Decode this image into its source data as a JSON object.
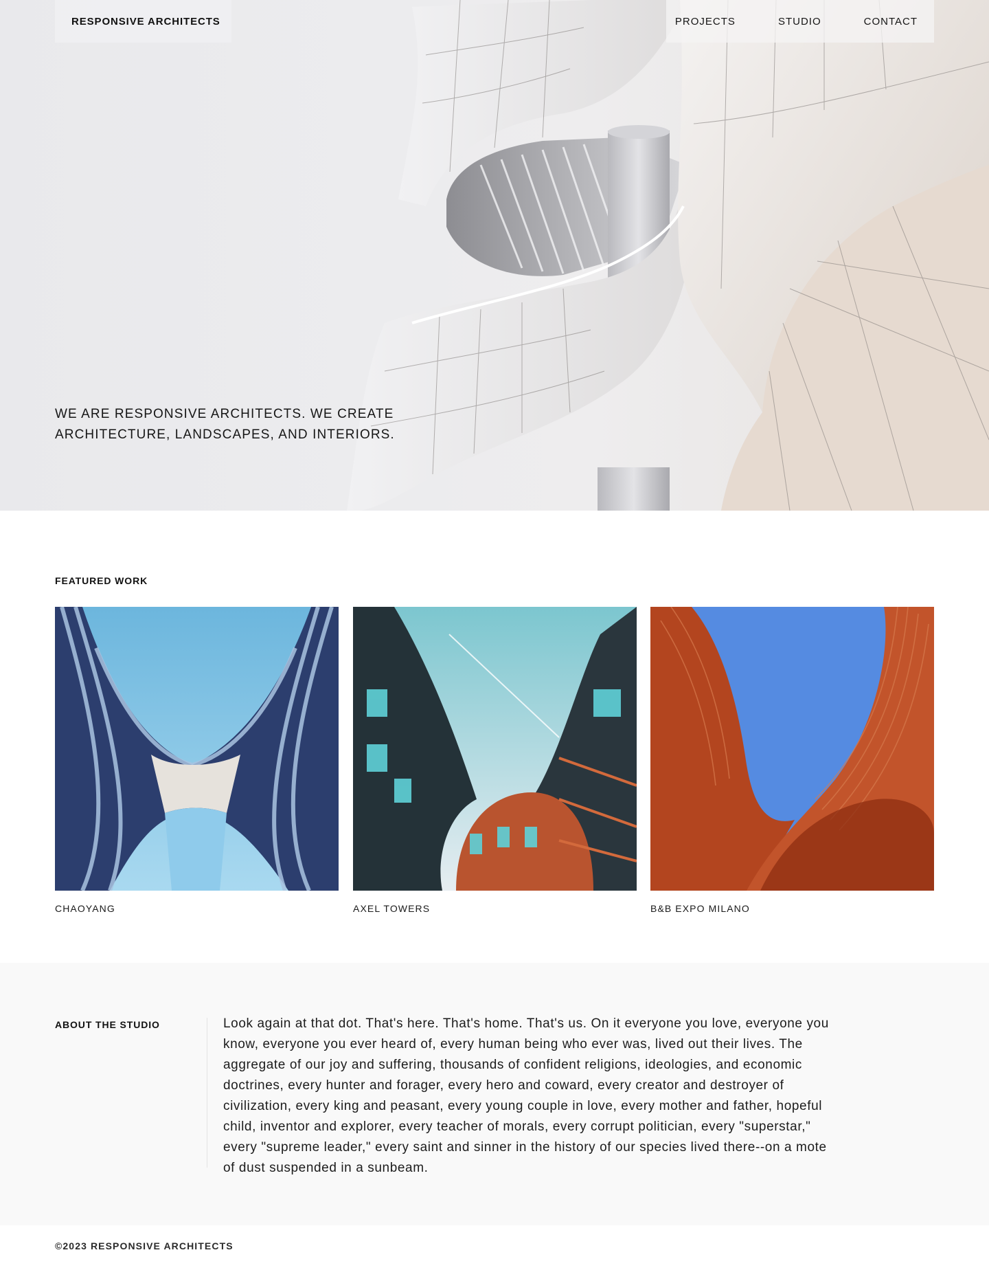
{
  "header": {
    "brand": "RESPONSIVE ARCHITECTS",
    "nav": [
      {
        "label": "PROJECTS"
      },
      {
        "label": "STUDIO"
      },
      {
        "label": "CONTACT"
      }
    ]
  },
  "hero": {
    "tagline": "WE ARE RESPONSIVE ARCHITECTS. WE CREATE ARCHITECTURE, LANDSCAPES, AND INTERIORS."
  },
  "featured": {
    "heading": "FEATURED WORK",
    "projects": [
      {
        "name": "CHAOYANG"
      },
      {
        "name": "AXEL TOWERS"
      },
      {
        "name": "B&B EXPO MILANO"
      }
    ]
  },
  "about": {
    "heading": "ABOUT THE STUDIO",
    "body": "Look again at that dot. That's here. That's home. That's us. On it everyone you love, everyone you know, everyone you ever heard of, every human being who ever was, lived out their lives. The aggregate of our joy and suffering, thousands of confident religions, ideologies, and economic doctrines, every hunter and forager, every hero and coward, every creator and destroyer of civilization, every king and peasant, every young couple in love, every mother and father, hopeful child, inventor and explorer, every teacher of morals, every corrupt politician, every \"superstar,\" every \"supreme leader,\" every saint and sinner in the history of our species lived there--on a mote of dust suspended in a sunbeam."
  },
  "footer": {
    "copyright": "©2023 RESPONSIVE ARCHITECTS"
  },
  "colors": {
    "hero_bg": "#e9e9ec",
    "about_bg": "#f9f9f9",
    "text": "#111111"
  }
}
